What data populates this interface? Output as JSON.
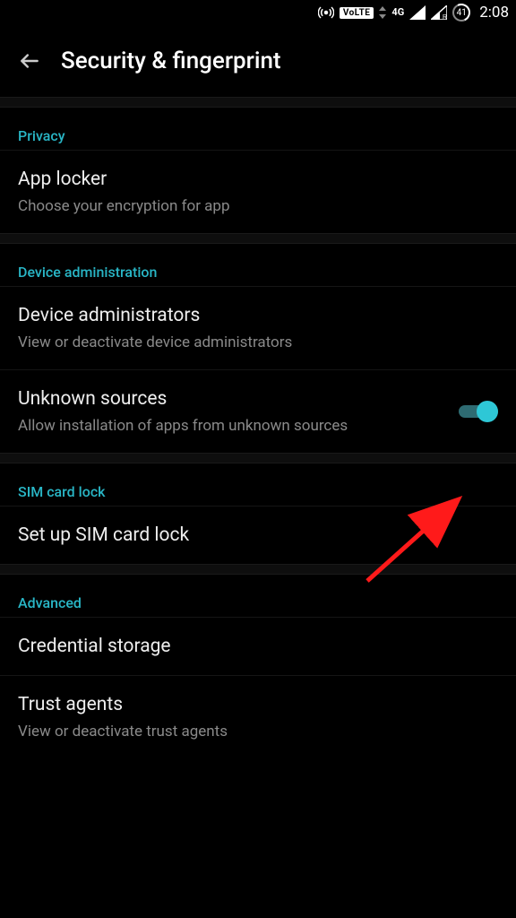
{
  "status": {
    "volte": "VoLTE",
    "net": "4G",
    "battery": "41",
    "time": "2:08"
  },
  "appbar": {
    "title": "Security & fingerprint"
  },
  "sections": {
    "privacy": {
      "header": "Privacy",
      "applocker_title": "App locker",
      "applocker_sub": "Choose your encryption for app"
    },
    "device": {
      "header": "Device administration",
      "admins_title": "Device administrators",
      "admins_sub": "View or deactivate device administrators",
      "unknown_title": "Unknown sources",
      "unknown_sub": "Allow installation of apps from unknown sources",
      "unknown_on": true
    },
    "sim": {
      "header": "SIM card lock",
      "setup_title": "Set up SIM card lock"
    },
    "advanced": {
      "header": "Advanced",
      "cred_title": "Credential storage",
      "trust_title": "Trust agents",
      "trust_sub": "View or deactivate trust agents"
    }
  }
}
